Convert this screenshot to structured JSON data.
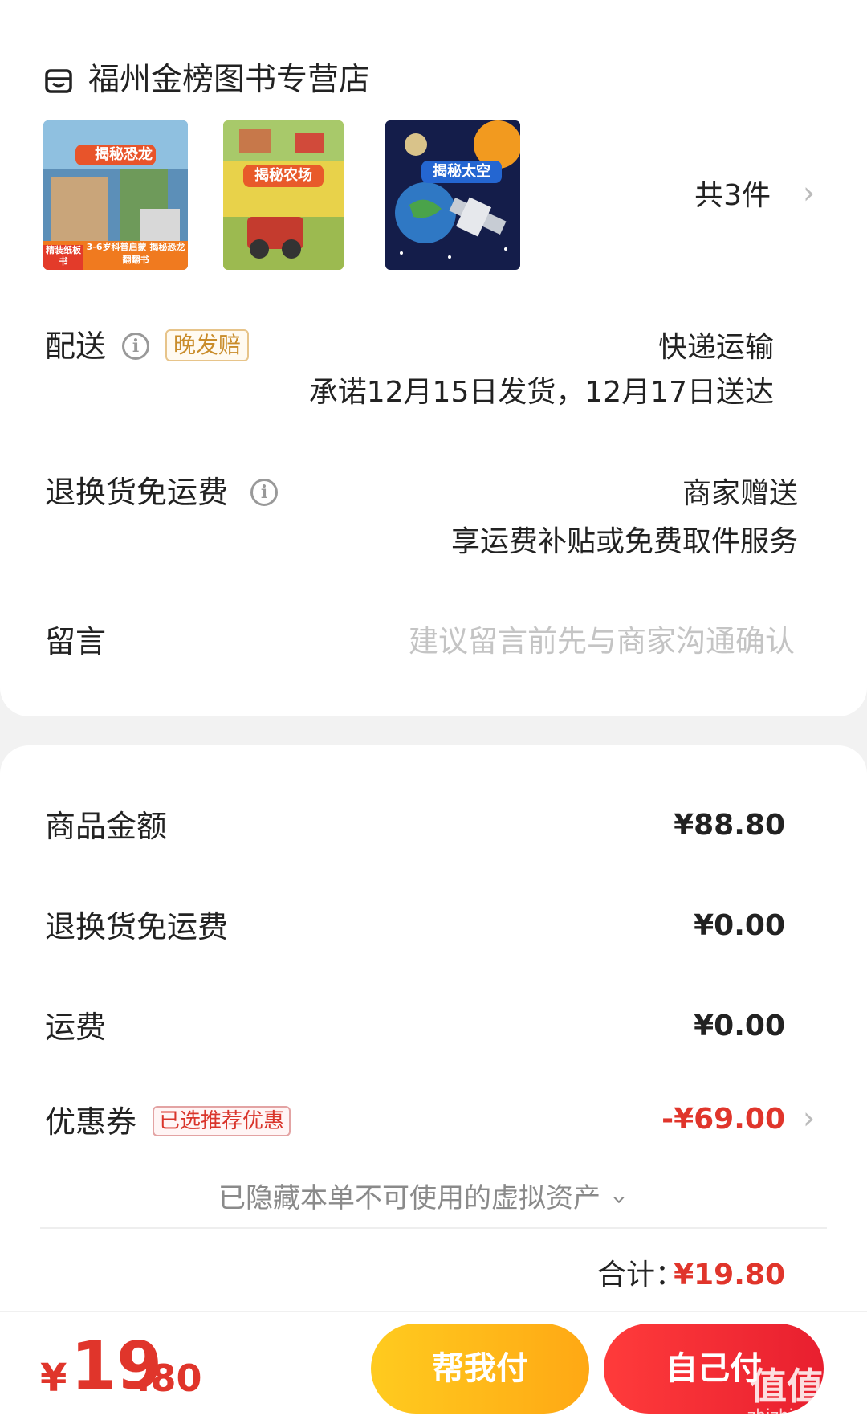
{
  "store": {
    "name": "福州金榜图书专营店",
    "icon": "store-icon"
  },
  "products": {
    "items": [
      {
        "title": "揭秘恐龙",
        "subtitle": "3-6岁科普启蒙 揭秘恐龙翻翻书",
        "badge": "精装纸板书"
      },
      {
        "title": "揭秘农场"
      },
      {
        "title": "揭秘太空"
      }
    ],
    "count_label": "共3件"
  },
  "delivery": {
    "label": "配送",
    "tag": "晚发赔",
    "method": "快递运输",
    "promise": "承诺12月15日发货，12月17日送达"
  },
  "return_shipping": {
    "label": "退换货免运费",
    "provider": "商家赠送",
    "desc": "享运费补贴或免费取件服务"
  },
  "message": {
    "label": "留言",
    "placeholder": "建议留言前先与商家沟通确认"
  },
  "summary": {
    "goods_label": "商品金额",
    "goods_value": "¥88.80",
    "return_label": "退换货免运费",
    "return_value": "¥0.00",
    "shipping_label": "运费",
    "shipping_value": "¥0.00",
    "coupon_label": "优惠券",
    "coupon_tag": "已选推荐优惠",
    "coupon_value": "-¥69.00",
    "hidden_assets": "已隐藏本单不可使用的虚拟资产",
    "total_label": "合计：",
    "total_value": "¥19.80"
  },
  "footer": {
    "pay_symbol": "¥",
    "pay_integer": "19",
    "pay_decimal": ".80",
    "help_pay_label": "帮我付",
    "self_pay_label": "自己付"
  },
  "watermark": {
    "text": "值值值",
    "sub": "zhizhizhi.com"
  },
  "colors": {
    "accent_red": "#e0352b",
    "gold": "#ffb81a",
    "tag_gold": "#c98c2a"
  }
}
